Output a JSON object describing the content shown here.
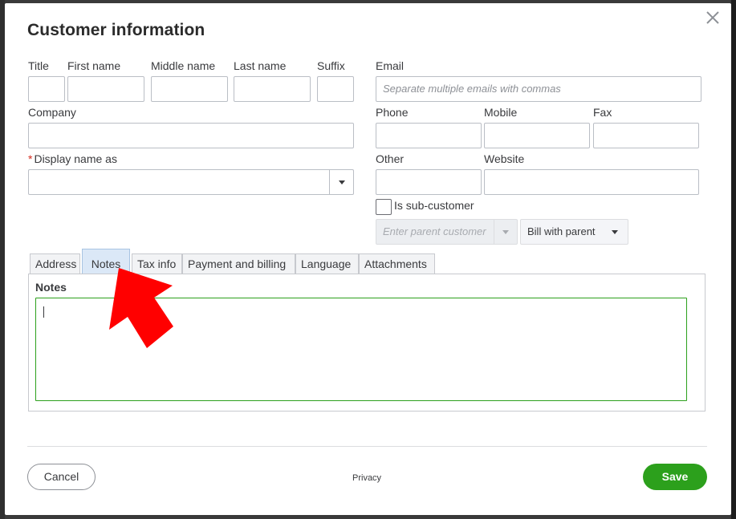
{
  "dialog": {
    "title": "Customer information",
    "close_icon": "close-x-icon"
  },
  "name_fields": {
    "title_label": "Title",
    "first_name_label": "First name",
    "middle_name_label": "Middle name",
    "last_name_label": "Last name",
    "suffix_label": "Suffix"
  },
  "company": {
    "label": "Company"
  },
  "display_name": {
    "required_marker": "*",
    "label": "Display name as"
  },
  "email": {
    "label": "Email",
    "placeholder": "Separate multiple emails with commas"
  },
  "phones": {
    "phone_label": "Phone",
    "mobile_label": "Mobile",
    "fax_label": "Fax",
    "other_label": "Other",
    "website_label": "Website"
  },
  "sub_customer": {
    "checkbox_label": "Is sub-customer",
    "parent_placeholder": "Enter parent customer",
    "bill_option": "Bill with parent"
  },
  "tabs": [
    {
      "label": "Address"
    },
    {
      "label": "Notes"
    },
    {
      "label": "Tax info"
    },
    {
      "label": "Payment and billing"
    },
    {
      "label": "Language"
    },
    {
      "label": "Attachments"
    }
  ],
  "active_tab": "Notes",
  "notes": {
    "label": "Notes",
    "value": ""
  },
  "footer": {
    "cancel_label": "Cancel",
    "privacy_label": "Privacy",
    "save_label": "Save"
  },
  "colors": {
    "accent_green": "#2ca01c",
    "active_tab_bg": "#dbe8f7",
    "annotation_arrow": "#ff0000"
  }
}
